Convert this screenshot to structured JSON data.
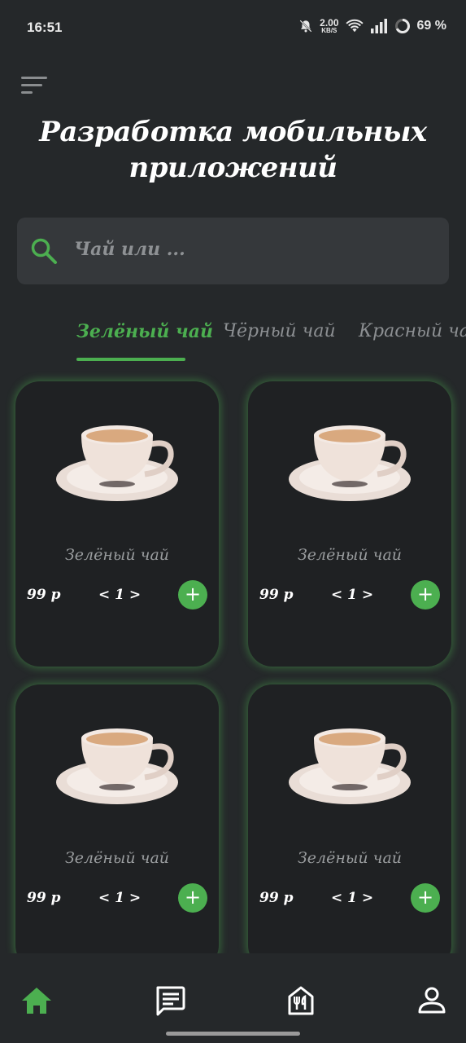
{
  "status_bar": {
    "time": "16:51",
    "net_speed_value": "2.00",
    "net_speed_unit": "KB/S",
    "battery": "69 %",
    "icons": [
      "mute-bell-icon",
      "wifi-icon",
      "signal-icon",
      "battery-ring-icon"
    ]
  },
  "header": {
    "menu_icon": "menu-icon",
    "title": "Разработка мобильных приложений"
  },
  "search": {
    "icon": "search-icon",
    "placeholder": "Чай или ..."
  },
  "tabs": [
    {
      "label": "Зелёный чай",
      "active": true
    },
    {
      "label": "Чёрный чай",
      "active": false
    },
    {
      "label": "Красный чай",
      "active": false
    }
  ],
  "products": [
    {
      "name": "Зелёный чай",
      "price": "99 р",
      "quantity": "< 1 >",
      "add": "+"
    },
    {
      "name": "Зелёный чай",
      "price": "99 р",
      "quantity": "< 1 >",
      "add": "+"
    },
    {
      "name": "Зелёный чай",
      "price": "99 р",
      "quantity": "< 1 >",
      "add": "+"
    },
    {
      "name": "Зелёный чай",
      "price": "99 р",
      "quantity": "< 1 >",
      "add": "+"
    }
  ],
  "bottom_nav": [
    {
      "icon": "home-icon",
      "active": true
    },
    {
      "icon": "chat-icon",
      "active": false
    },
    {
      "icon": "restaurant-icon",
      "active": false
    },
    {
      "icon": "profile-icon",
      "active": false
    }
  ],
  "colors": {
    "background": "#25282a",
    "card": "#1f2123",
    "accent": "#4caf50",
    "search_bg": "#35383b",
    "muted_text": "#8c8f92"
  }
}
